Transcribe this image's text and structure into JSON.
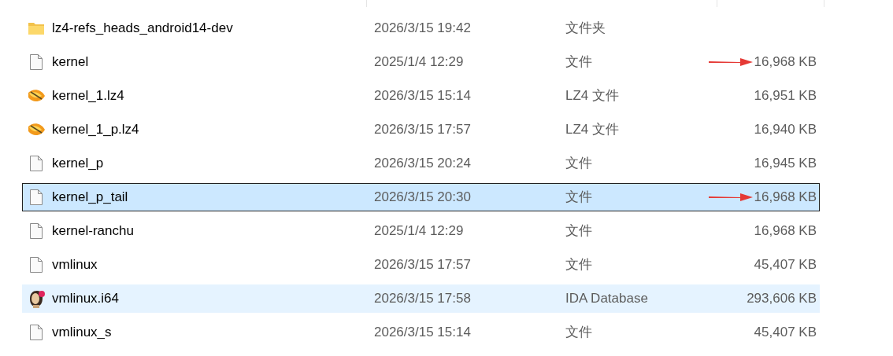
{
  "files": [
    {
      "kind": "folder",
      "name": "lz4-refs_heads_android14-dev",
      "modified": "2026/3/15 19:42",
      "type": "文件夹",
      "selected": false,
      "hovered": false,
      "annotated": false
    },
    {
      "kind": "file",
      "name": "kernel",
      "modified": "2025/1/4 12:29",
      "type": "文件",
      "size": "16,968 KB",
      "selected": false,
      "hovered": false,
      "annotated": true
    },
    {
      "kind": "lz4",
      "name": "kernel_1.lz4",
      "modified": "2026/3/15 15:14",
      "type": "LZ4 文件",
      "size": "16,951 KB",
      "selected": false,
      "hovered": false,
      "annotated": false
    },
    {
      "kind": "lz4",
      "name": "kernel_1_p.lz4",
      "modified": "2026/3/15 17:57",
      "type": "LZ4 文件",
      "size": "16,940 KB",
      "selected": false,
      "hovered": false,
      "annotated": false
    },
    {
      "kind": "file",
      "name": "kernel_p",
      "modified": "2026/3/15 20:24",
      "type": "文件",
      "size": "16,945 KB",
      "selected": false,
      "hovered": false,
      "annotated": false
    },
    {
      "kind": "file",
      "name": "kernel_p_tail",
      "modified": "2026/3/15 20:30",
      "type": "文件",
      "size": "16,968 KB",
      "selected": true,
      "hovered": false,
      "annotated": true
    },
    {
      "kind": "file",
      "name": "kernel-ranchu",
      "modified": "2025/1/4 12:29",
      "type": "文件",
      "size": "16,968 KB",
      "selected": false,
      "hovered": false,
      "annotated": false
    },
    {
      "kind": "file",
      "name": "vmlinux",
      "modified": "2026/3/15 17:57",
      "type": "文件",
      "size": "45,407 KB",
      "selected": false,
      "hovered": false,
      "annotated": false
    },
    {
      "kind": "ida",
      "name": "vmlinux.i64",
      "modified": "2026/3/15 17:58",
      "type": "IDA Database",
      "size": "293,606 KB",
      "selected": false,
      "hovered": true,
      "annotated": false
    },
    {
      "kind": "file",
      "name": "vmlinux_s",
      "modified": "2026/3/15 15:14",
      "type": "文件",
      "size": "45,407 KB",
      "selected": false,
      "hovered": false,
      "annotated": false
    }
  ]
}
